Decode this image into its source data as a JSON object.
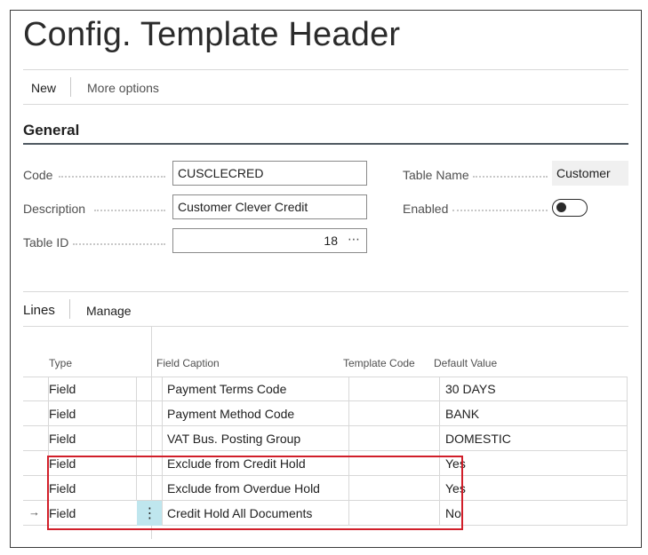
{
  "page": {
    "title": "Config. Template Header"
  },
  "actions": {
    "new_label": "New",
    "more_label": "More options"
  },
  "general": {
    "title": "General",
    "code": {
      "label": "Code",
      "value": "CUSCLECRED"
    },
    "description": {
      "label": "Description",
      "value": "Customer Clever Credit"
    },
    "table_id": {
      "label": "Table ID",
      "value": "18",
      "lookup": "⋯"
    },
    "table_name": {
      "label": "Table Name",
      "value": "Customer"
    },
    "enabled": {
      "label": "Enabled",
      "on": false
    }
  },
  "lines": {
    "tab_label": "Lines",
    "manage_label": "Manage",
    "columns": {
      "type": "Type",
      "field_caption": "Field Caption",
      "template_code": "Template Code",
      "default_value": "Default Value"
    },
    "rows": [
      {
        "type": "Field",
        "field_caption": "Payment Terms Code",
        "template_code": "",
        "default_value": "30 DAYS"
      },
      {
        "type": "Field",
        "field_caption": "Payment Method Code",
        "template_code": "",
        "default_value": "BANK"
      },
      {
        "type": "Field",
        "field_caption": "VAT Bus. Posting Group",
        "template_code": "",
        "default_value": "DOMESTIC"
      },
      {
        "type": "Field",
        "field_caption": "Exclude from Credit Hold",
        "template_code": "",
        "default_value": "Yes"
      },
      {
        "type": "Field",
        "field_caption": "Exclude from Overdue Hold",
        "template_code": "",
        "default_value": "Yes"
      },
      {
        "type": "Field",
        "field_caption": "Credit Hold All Documents",
        "template_code": "",
        "default_value": "No"
      }
    ],
    "current_row_indicator": "→",
    "row_menu_glyph": "⋮"
  },
  "colors": {
    "highlight": "#d11f2a",
    "selected_cell": "#bfe6ee",
    "section_rule": "#505a62"
  }
}
